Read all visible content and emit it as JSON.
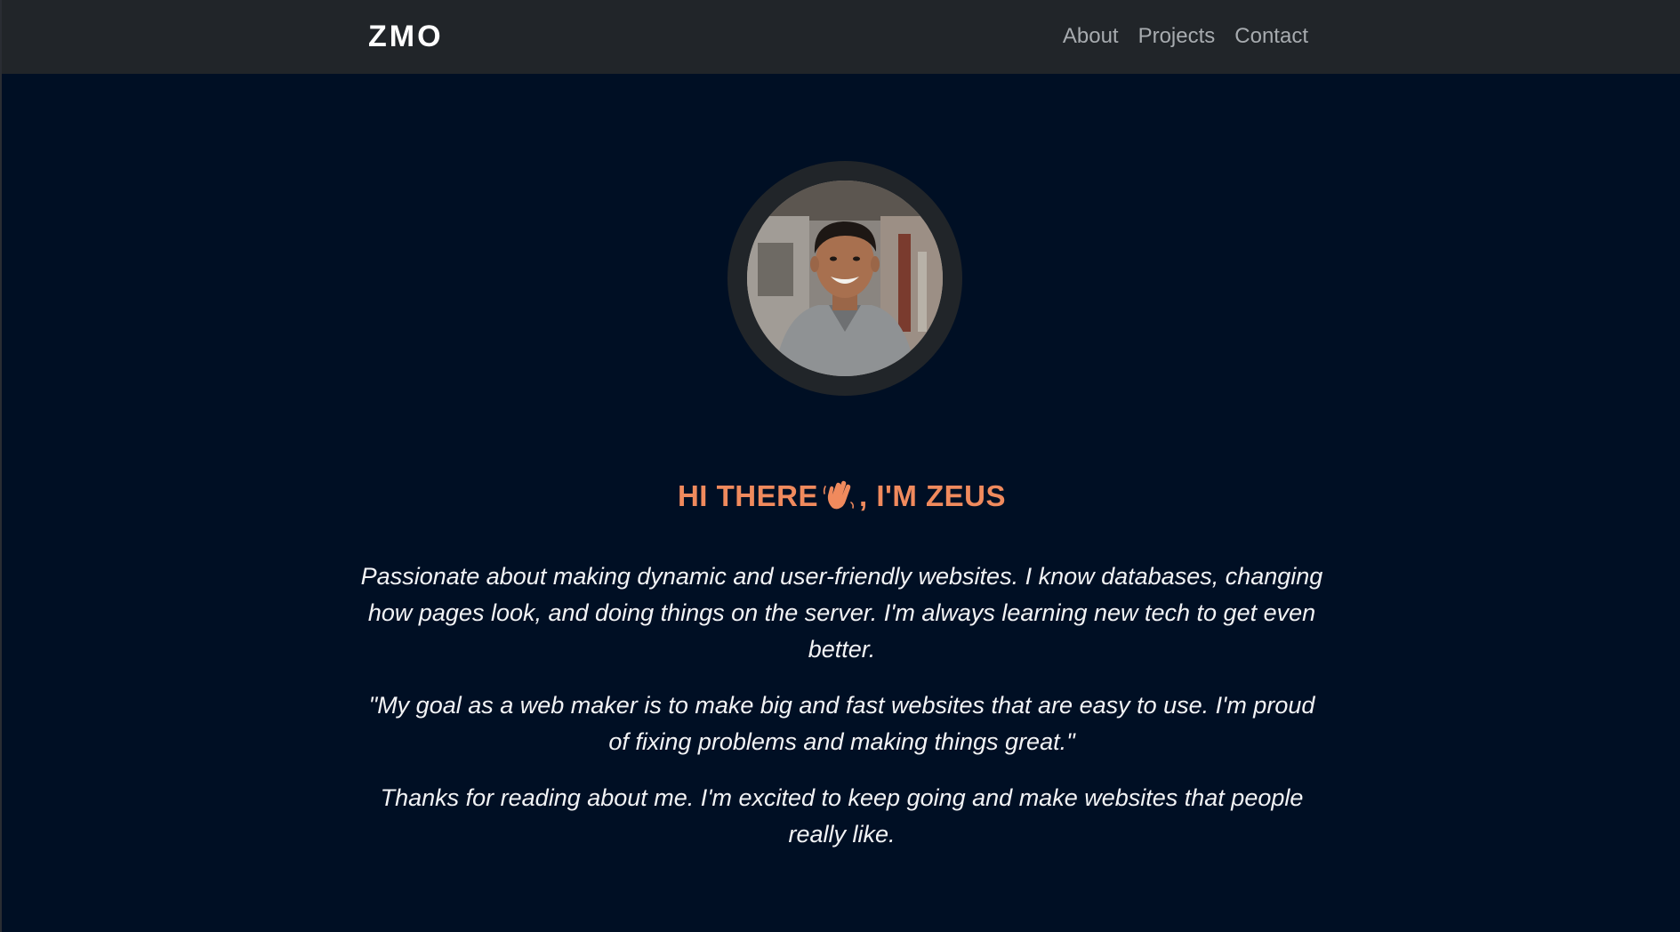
{
  "navbar": {
    "brand": "ZMO",
    "links": [
      "About",
      "Projects",
      "Contact"
    ]
  },
  "hero": {
    "greeting_before": "HI THERE",
    "greeting_icon": "waving-hand-icon",
    "greeting_after": ", I'M ZEUS",
    "paragraphs": [
      "Passionate about making dynamic and user-friendly websites. I know databases, changing how pages look, and doing things on the server. I'm always learning new tech to get even better.",
      "\"My goal as a web maker is to make big and fast websites that are easy to use. I'm proud of fixing problems and making things great.\"",
      "Thanks for reading about me. I'm excited to keep going and make websites that people really like."
    ]
  },
  "colors": {
    "background": "#000f24",
    "navbar": "#212529",
    "accent": "#f08a5d",
    "nav_link": "#a7abaf",
    "text": "#f2f3f5"
  }
}
